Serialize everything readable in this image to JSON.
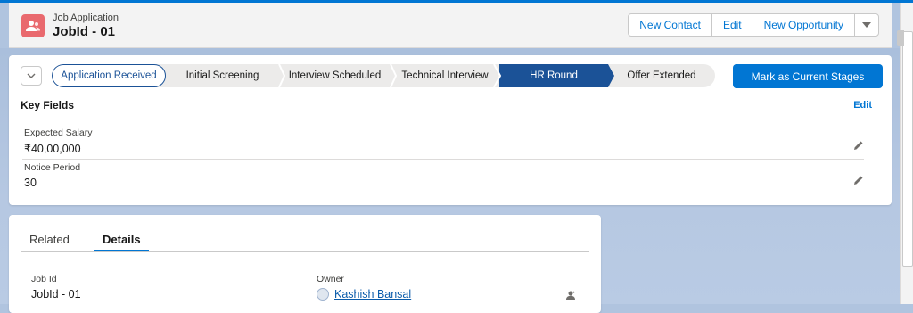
{
  "colors": {
    "brand": "#0176d3",
    "object_icon": "#e9696e",
    "path_active": "#1b5297"
  },
  "header": {
    "object_type": "Job Application",
    "record_title": "JobId - 01",
    "object_icon": "contact-users-icon",
    "actions": [
      "New Contact",
      "Edit",
      "New Opportunity"
    ],
    "more_icon": "chevron-down-icon"
  },
  "path": {
    "toggle_icon": "chevron-down-icon",
    "stages": [
      "Application Received",
      "Initial Screening",
      "Interview Scheduled",
      "Technical Interview",
      "HR Round",
      "Offer Extended"
    ],
    "current_stage": "Application Received",
    "selected_stage": "HR Round",
    "mark_button": "Mark as Current Stages"
  },
  "key_fields": {
    "title": "Key Fields",
    "edit": "Edit",
    "fields": [
      {
        "label": "Expected Salary",
        "value": "₹40,00,000"
      },
      {
        "label": "Notice Period",
        "value": "30"
      }
    ]
  },
  "tabs": {
    "related": "Related",
    "details": "Details",
    "active": "Details"
  },
  "details": {
    "job_id_label": "Job Id",
    "job_id_value": "JobId - 01",
    "owner_label": "Owner",
    "owner_value": "Kashish Bansal"
  }
}
